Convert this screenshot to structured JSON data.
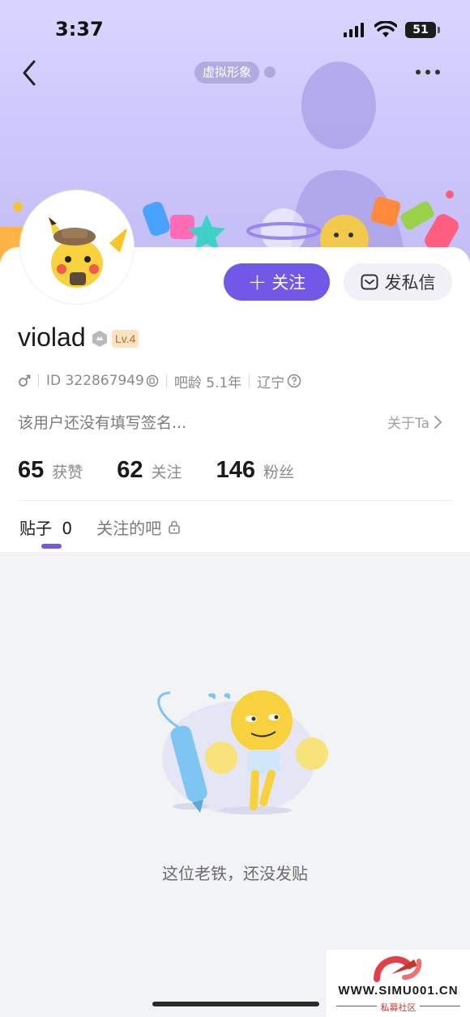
{
  "status_bar": {
    "time": "3:37",
    "battery": "51"
  },
  "header": {
    "avatar_chip_label": "虚拟形象"
  },
  "profile": {
    "username": "violad",
    "level": "Lv.4",
    "id_text": "ID 322867949",
    "tieba_age": "吧龄 5.1年",
    "location": "辽宁",
    "signature": "该用户还没有填写签名...",
    "about_label": "关于Ta"
  },
  "actions": {
    "follow_label": "关注",
    "message_label": "发私信"
  },
  "stats": [
    {
      "value": "65",
      "label": "获赞"
    },
    {
      "value": "62",
      "label": "关注"
    },
    {
      "value": "146",
      "label": "粉丝"
    }
  ],
  "tabs": [
    {
      "label": "贴子",
      "count": "0"
    },
    {
      "label": "关注的吧"
    }
  ],
  "empty_state": {
    "text": "这位老铁，还没发贴"
  },
  "watermark": {
    "domain": "WWW.SIMU001.CN",
    "subtitle": "私募社区"
  },
  "colors": {
    "accent": "#7158e6",
    "banner": "#cdc7fb",
    "level_badge": "#fbe2c2"
  },
  "icons": [
    "chevron-left-icon",
    "more-dots-icon",
    "male-icon",
    "copy-icon",
    "help-circle-icon",
    "chevron-right-icon",
    "lock-icon",
    "mail-icon",
    "plus-icon"
  ]
}
